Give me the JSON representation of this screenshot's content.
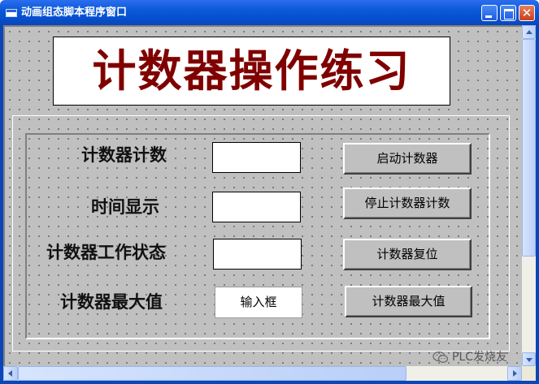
{
  "window": {
    "title": "动画组态脚本程序窗口",
    "minimize_icon": "minimize-icon",
    "maximize_icon": "maximize-icon",
    "close_icon": "close-icon",
    "close_glyph": "✕"
  },
  "banner": {
    "title": "计数器操作练习",
    "text_color": "#800000"
  },
  "form": {
    "rows": [
      {
        "label": "计数器计数",
        "field_value": "",
        "button_label": "启动计数器"
      },
      {
        "label": "时间显示",
        "field_value": "",
        "button_label": "停止计数器计数"
      },
      {
        "label": "计数器工作状态",
        "field_value": "",
        "button_label": "计数器复位"
      },
      {
        "label": "计数器最大值",
        "field_value": "输入框",
        "button_label": "计数器最大值"
      }
    ]
  },
  "watermark": {
    "text": "PLC发烧友",
    "icon": "wechat-icon"
  },
  "colors": {
    "titlebar": "#0a5ad8",
    "canvas": "#c0c0c0"
  }
}
